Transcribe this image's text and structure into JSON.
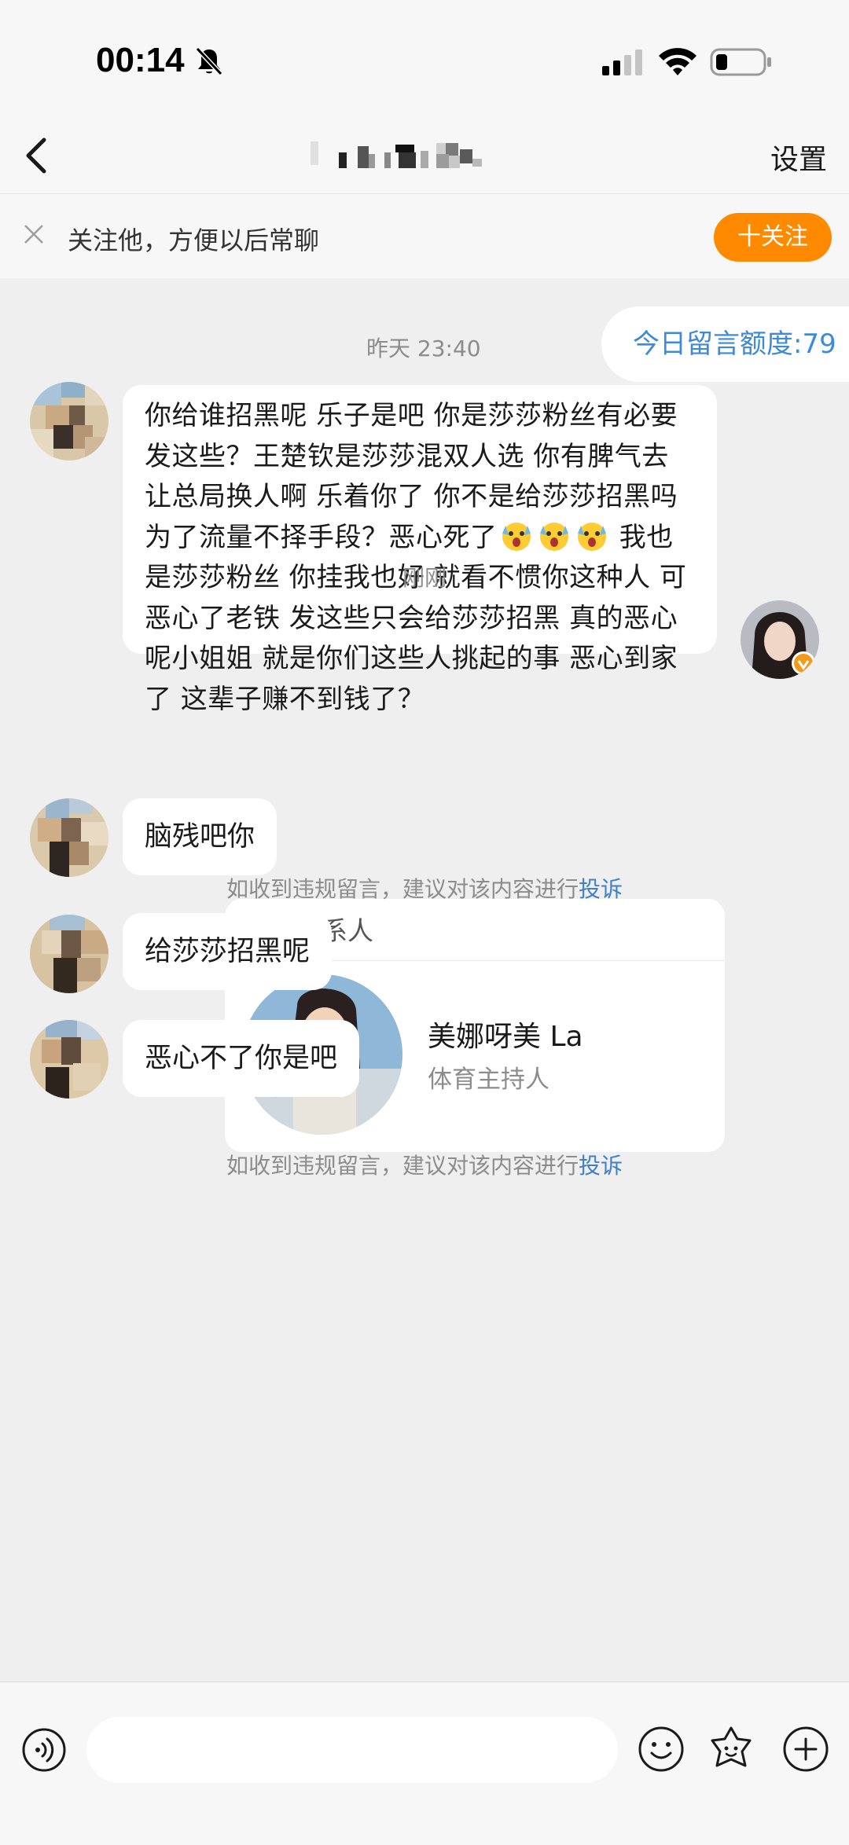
{
  "status_bar": {
    "time": "00:14",
    "icons": [
      "mute-bell-icon",
      "cellular-signal-icon",
      "wifi-icon",
      "battery-icon"
    ]
  },
  "nav": {
    "back_icon": "chevron-left-icon",
    "settings_label": "设置"
  },
  "follow_banner": {
    "text": "关注他，方便以后常聊",
    "button_label": "十关注",
    "button_color": "#ff8a00"
  },
  "chat": {
    "quota_label": "今日留言额度:79",
    "timestamp_1": "昨天 23:40",
    "long_message": {
      "part_1": "你给谁招黑呢 乐子是吧 你是莎莎粉丝有必要发这些？王楚钦是莎莎混双人选 你有脾气去让总局换人啊 乐着你了 你不是给莎莎招黑吗 为了流量不择手段？恶心死了",
      "emoji": "😱",
      "part_2": " 我也是莎莎粉丝 你挂我也好 就看不惯你这种人 可恶心了老铁 发这些只会给莎莎招黑 真的恶心呢小姐姐 就是你们这些人挑起的事 恶心到家了 这辈子赚不到钱了？"
    },
    "timestamp_2": "刚刚",
    "contact_card": {
      "header": "推荐联系人",
      "name": "美娜呀美 La",
      "subtitle": "体育主持人"
    },
    "message_2": "脑残吧你",
    "notice": {
      "text": "如收到违规留言，建议对该内容进行",
      "link": "投诉"
    },
    "message_3": "给莎莎招黑呢",
    "message_4": "恶心不了你是吧"
  },
  "input_bar": {
    "placeholder": "",
    "icons": [
      "voice-icon",
      "emoji-icon",
      "sticker-icon",
      "plus-icon"
    ]
  },
  "colors": {
    "accent_blue": "#3d8ad8",
    "link_blue": "#3d7fc8",
    "follow_orange": "#ff8a00",
    "chat_background": "#efefef"
  }
}
